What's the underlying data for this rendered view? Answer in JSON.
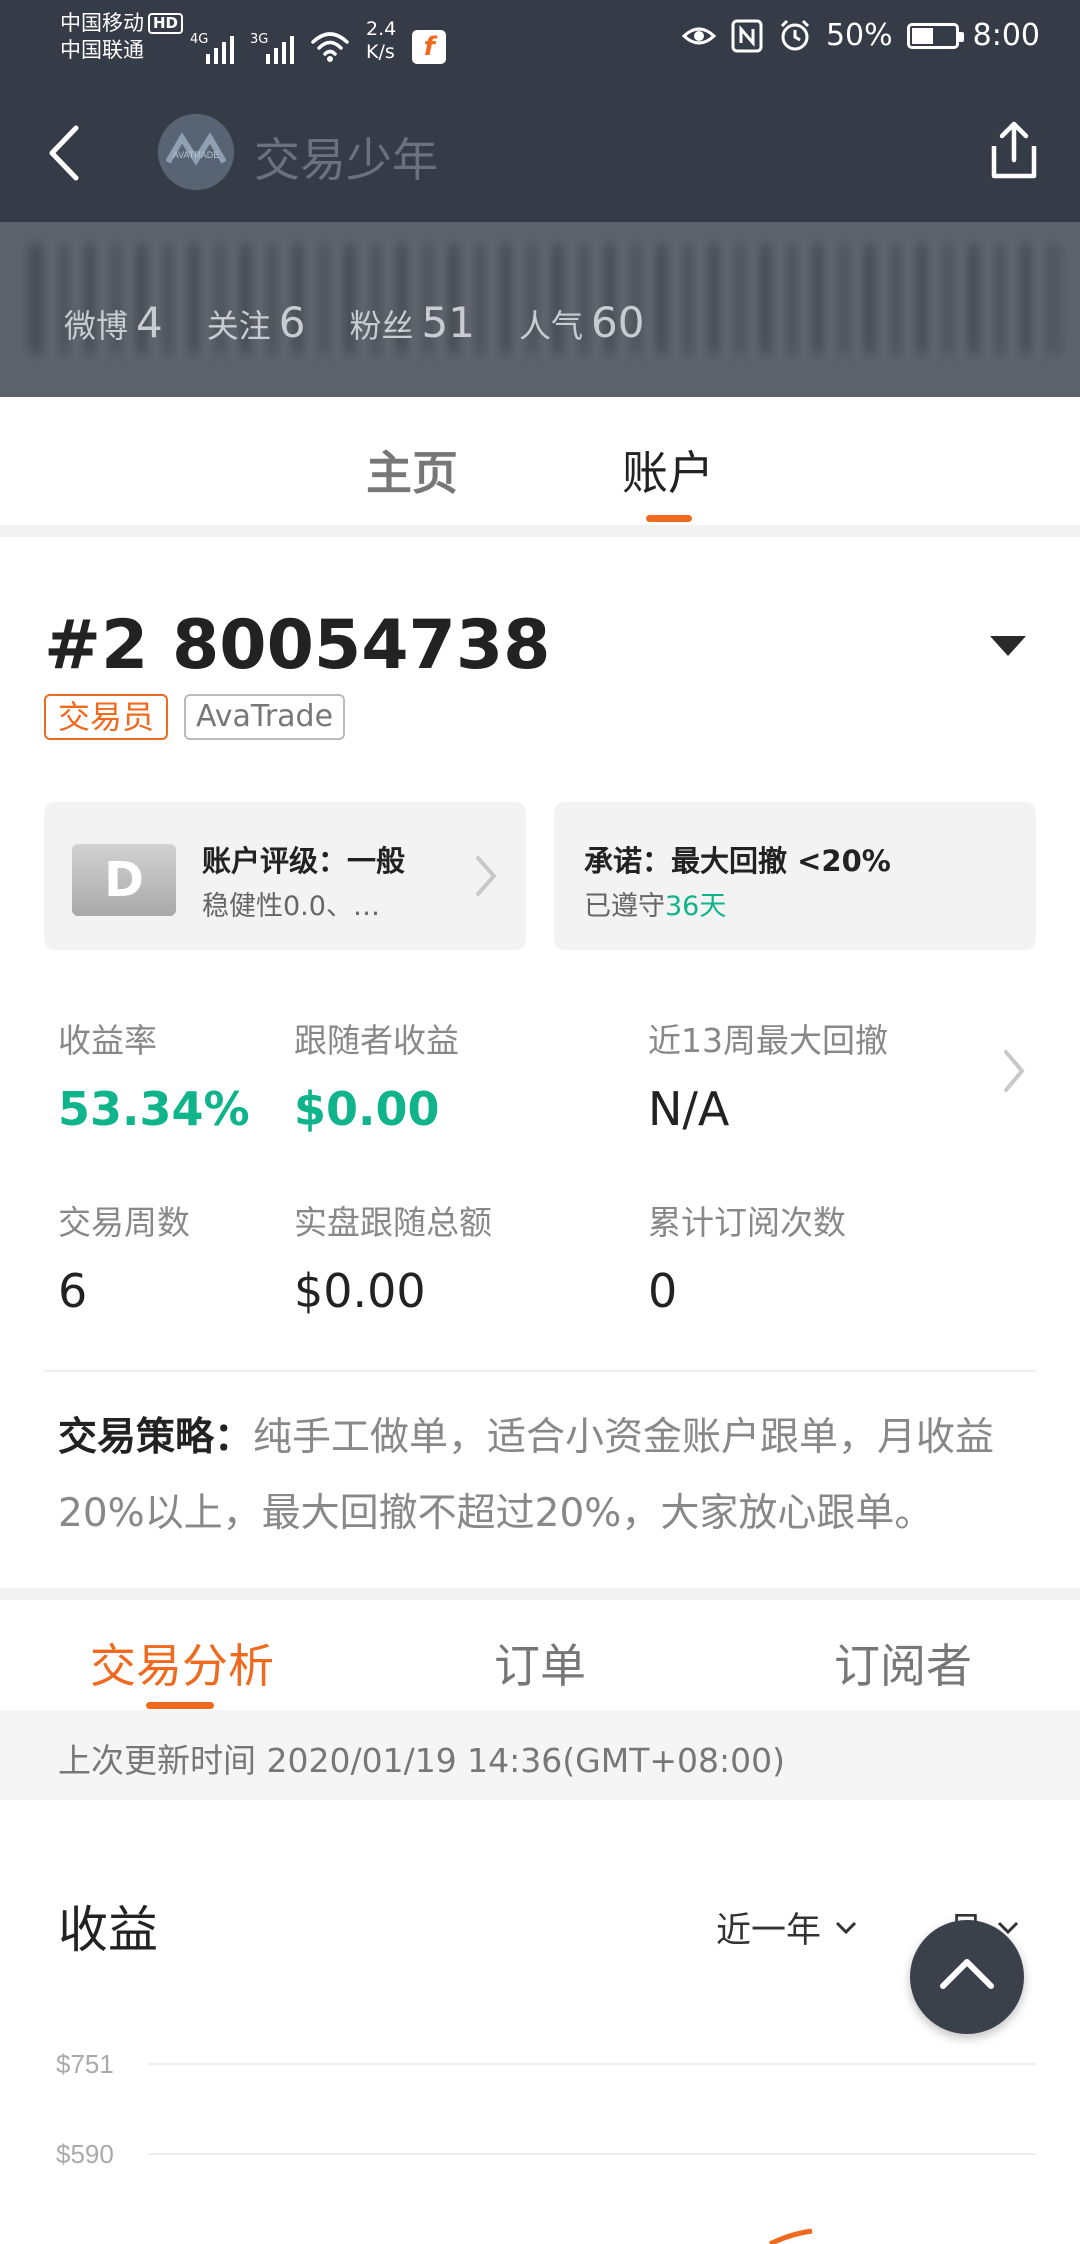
{
  "status_bar": {
    "carrier1": "中国移动",
    "carrier1_badge": "HD",
    "carrier2": "中国联通",
    "signal1_tag": "4G",
    "signal2_tag": "3G",
    "speed_value": "2.4",
    "speed_unit": "K/s",
    "battery": "50%",
    "battery_level": 0.5,
    "time": "8:00"
  },
  "header": {
    "user_name": "交易少年",
    "avatar_text": "AVATRADE"
  },
  "profile_stats": [
    {
      "label": "微博",
      "value": "4"
    },
    {
      "label": "关注",
      "value": "6"
    },
    {
      "label": "粉丝",
      "value": "51"
    },
    {
      "label": "人气",
      "value": "60"
    }
  ],
  "profile_tabs": {
    "home": "主页",
    "account": "账户"
  },
  "account": {
    "number": "#2 80054738",
    "role_tag": "交易员",
    "broker_tag": "AvaTrade"
  },
  "rating_card": {
    "grade": "D",
    "title": "账户评级：一般",
    "subtitle": "稳健性0.0、…"
  },
  "promise_card": {
    "title": "承诺：最大回撤 <20%",
    "kept_prefix": "已遵守",
    "kept_days": "36天"
  },
  "metrics": [
    {
      "label": "收益率",
      "value": "53.34%"
    },
    {
      "label": "跟随者收益",
      "value": "$0.00"
    },
    {
      "label": "近13周最大回撤",
      "value": "N/A"
    },
    {
      "label": "交易周数",
      "value": "6"
    },
    {
      "label": "实盘跟随总额",
      "value": "$0.00"
    },
    {
      "label": "累计订阅次数",
      "value": "0"
    }
  ],
  "strategy": {
    "label": "交易策略：",
    "text": "纯手工做单，适合小资金账户跟单，月收益20%以上，最大回撤不超过20%，大家放心跟单。"
  },
  "analysis_tabs": [
    "交易分析",
    "订单",
    "订阅者"
  ],
  "update_text": "上次更新时间 2020/01/19 14:36(GMT+08:00)",
  "profit": {
    "title": "收益",
    "range_selector": "近一年",
    "period_selector": "月"
  },
  "chart_data": {
    "type": "line",
    "title": "收益",
    "y_ticks": [
      "$751",
      "$590"
    ],
    "grid": true,
    "colors": {
      "line": "#ef6a1e",
      "grid": "#eeeeee"
    }
  },
  "colors": {
    "accent": "#ef6a1e",
    "positive": "#10b48a",
    "header_bg": "#353c47"
  },
  "icons": {
    "back": "back-arrow-icon",
    "share": "share-icon",
    "dropdown": "caret-down-icon",
    "scroll_top": "chevron-up-icon"
  }
}
